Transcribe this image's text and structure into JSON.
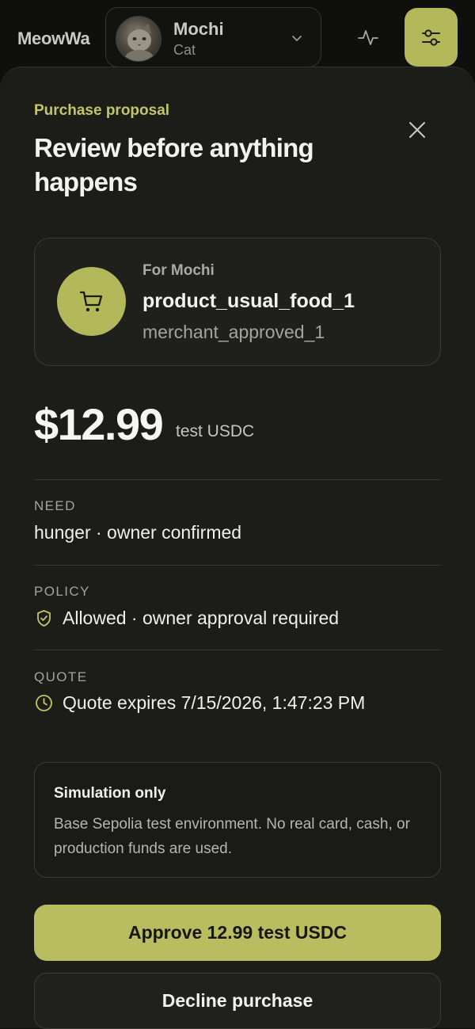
{
  "header": {
    "brand": "MeowWa",
    "pet": {
      "name": "Mochi",
      "kind": "Cat"
    },
    "icons": {
      "activity": "activity-pulse-icon",
      "filters": "sliders-icon",
      "dropdown": "chevron-down-icon"
    }
  },
  "sheet": {
    "eyebrow": "Purchase proposal",
    "title": "Review before anything happens",
    "product": {
      "for_label": "For Mochi",
      "name": "product_usual_food_1",
      "merchant": "merchant_approved_1",
      "icon": "cart-icon"
    },
    "price": {
      "amount": "$12.99",
      "unit": "test USDC"
    },
    "need": {
      "label": "NEED",
      "value": "hunger · owner confirmed"
    },
    "policy": {
      "label": "POLICY",
      "value": "Allowed · owner approval required",
      "icon": "shield-check-icon"
    },
    "quote": {
      "label": "QUOTE",
      "value": "Quote expires 7/15/2026, 1:47:23 PM",
      "icon": "clock-icon"
    },
    "simulation": {
      "title": "Simulation only",
      "body": "Base Sepolia test environment. No real card, cash, or production funds are used."
    },
    "actions": {
      "approve": "Approve 12.99 test USDC",
      "decline": "Decline purchase"
    }
  },
  "colors": {
    "accent": "#b9bd5f",
    "eyebrow": "#c1c66a",
    "background": "#0f100d",
    "sheet": "#1c1d19"
  }
}
